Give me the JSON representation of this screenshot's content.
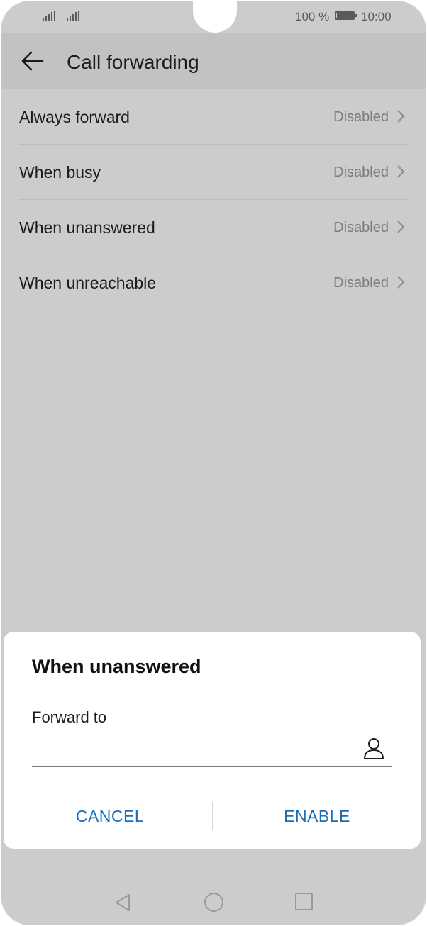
{
  "status_bar": {
    "battery_percent": "100 %",
    "time": "10:00",
    "icons": [
      "signal-icon",
      "signal-icon",
      "battery-icon"
    ]
  },
  "header": {
    "title": "Call forwarding",
    "back_icon": "arrow-left-icon"
  },
  "options": [
    {
      "label": "Always forward",
      "value": "Disabled"
    },
    {
      "label": "When busy",
      "value": "Disabled"
    },
    {
      "label": "When unanswered",
      "value": "Disabled"
    },
    {
      "label": "When unreachable",
      "value": "Disabled"
    }
  ],
  "dialog": {
    "title": "When unanswered",
    "field_label": "Forward to",
    "field_value": "",
    "contact_icon": "person-icon",
    "cancel_label": "CANCEL",
    "enable_label": "ENABLE"
  },
  "nav_bar": {
    "icons": [
      "triangle-back-icon",
      "circle-home-icon",
      "square-recents-icon"
    ]
  },
  "colors": {
    "accent": "#1a6db7",
    "scrim_background": "#cccccc",
    "dialog_background": "#ffffff"
  }
}
